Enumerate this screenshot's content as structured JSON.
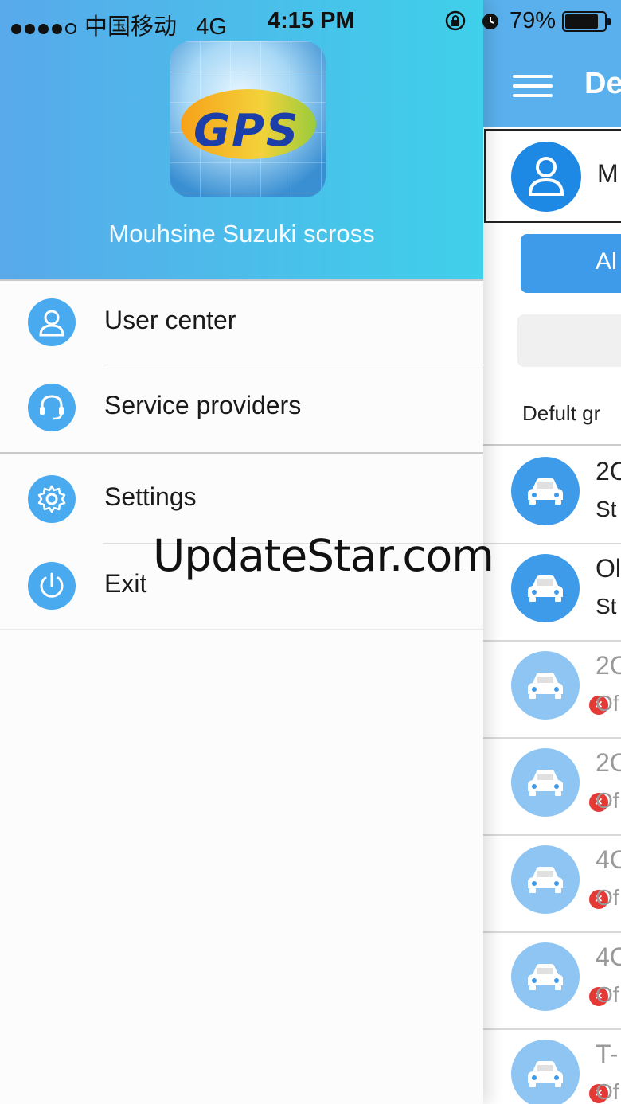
{
  "status_bar": {
    "carrier": "中国移动",
    "network": "4G",
    "time": "4:15 PM",
    "battery_percent": "79%",
    "battery_level": 0.79
  },
  "drawer": {
    "logo_text": "GPS",
    "account_name": "Mouhsine Suzuki scross",
    "menu": [
      {
        "label": "User center",
        "icon": "user-icon"
      },
      {
        "label": "Service providers",
        "icon": "headset-icon"
      },
      {
        "label": "Settings",
        "icon": "gear-icon"
      },
      {
        "label": "Exit",
        "icon": "power-icon"
      }
    ]
  },
  "background_page": {
    "title": "De",
    "username": "M",
    "all_button": "Al",
    "group_label": "Defult gr",
    "devices": [
      {
        "name": "2C",
        "status": "St",
        "online": true
      },
      {
        "name": "Ol",
        "status": "St",
        "online": true
      },
      {
        "name": "2C",
        "status": "Of",
        "online": false
      },
      {
        "name": "2C",
        "status": "Of",
        "online": false
      },
      {
        "name": "4C",
        "status": "Of",
        "online": false
      },
      {
        "name": "4C",
        "status": "Of",
        "online": false
      },
      {
        "name": "T-",
        "status": "Of",
        "online": false
      }
    ]
  },
  "watermark": "UpdateStar.com",
  "colors": {
    "header_gradient_start": "#58a9ea",
    "header_gradient_end": "#3fd0ea",
    "accent": "#3d9be9",
    "offline_badge": "#e53935"
  }
}
